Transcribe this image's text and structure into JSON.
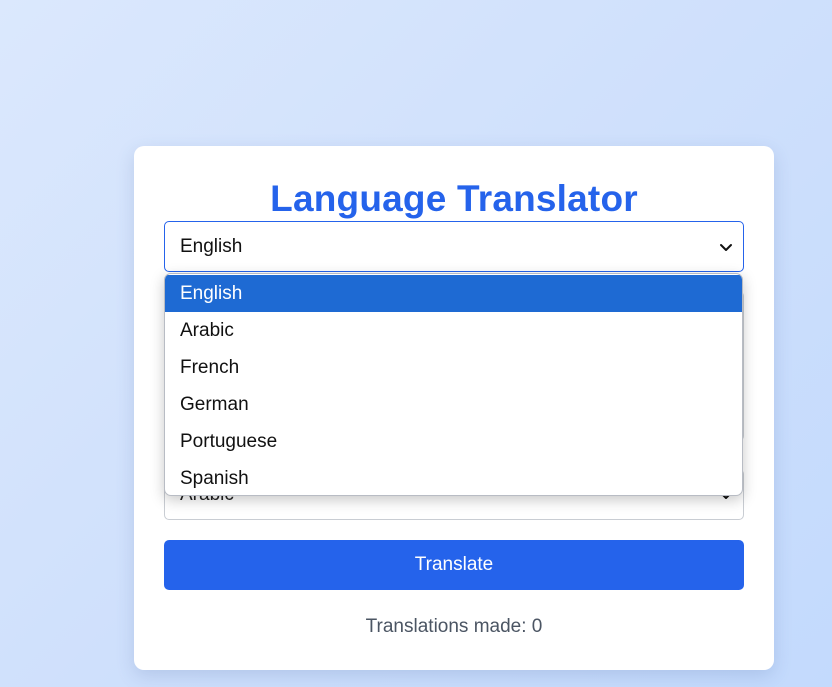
{
  "app": {
    "title": "Language Translator"
  },
  "source_select": {
    "value": "English"
  },
  "target_select": {
    "value": "Arabic"
  },
  "dropdown": {
    "options": [
      "English",
      "Arabic",
      "French",
      "German",
      "Portuguese",
      "Spanish"
    ],
    "selected": "English"
  },
  "translate_button": {
    "label": "Translate"
  },
  "counter": {
    "text": "Translations made: 0"
  },
  "colors": {
    "accent": "#2563eb",
    "option_highlight": "#1e6ad3",
    "counter_text": "#4b5563"
  },
  "icons": {
    "select_arrow": "chevron-down-icon"
  }
}
